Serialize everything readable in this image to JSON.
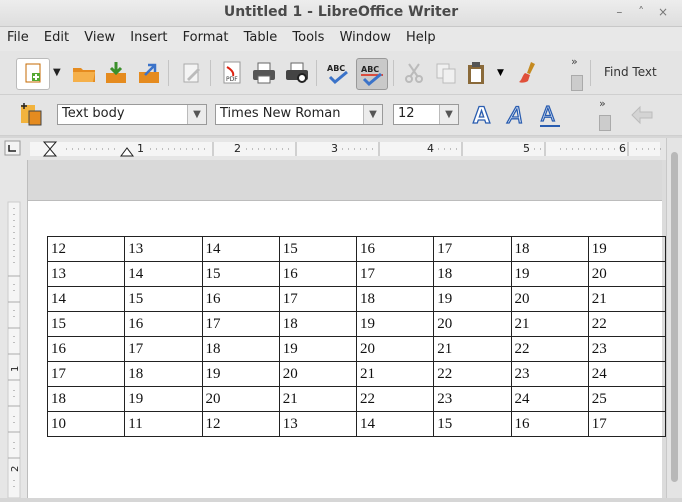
{
  "window": {
    "title": "Untitled 1 - LibreOffice Writer",
    "buttons": [
      "–",
      "˄",
      "×"
    ]
  },
  "menu": [
    "File",
    "Edit",
    "View",
    "Insert",
    "Format",
    "Table",
    "Tools",
    "Window",
    "Help"
  ],
  "toolbar": {
    "find_label": "Find Text"
  },
  "formatting": {
    "style": "Text body",
    "font": "Times New Roman",
    "size": "12"
  },
  "ruler": {
    "numbers": [
      "1",
      "2",
      "3",
      "4",
      "5",
      "6"
    ]
  },
  "vruler": {
    "numbers": [
      "1",
      "2"
    ]
  },
  "table": {
    "rows": [
      [
        "12",
        "13",
        "14",
        "15",
        "16",
        "17",
        "18",
        "19"
      ],
      [
        "13",
        "14",
        "15",
        "16",
        "17",
        "18",
        "19",
        "20"
      ],
      [
        "14",
        "15",
        "16",
        "17",
        "18",
        "19",
        "20",
        "21"
      ],
      [
        "15",
        "16",
        "17",
        "18",
        "19",
        "20",
        "21",
        "22"
      ],
      [
        "16",
        "17",
        "18",
        "19",
        "20",
        "21",
        "22",
        "23"
      ],
      [
        "17",
        "18",
        "19",
        "20",
        "21",
        "22",
        "23",
        "24"
      ],
      [
        "18",
        "19",
        "20",
        "21",
        "22",
        "23",
        "24",
        "25"
      ],
      [
        "10",
        "11",
        "12",
        "13",
        "14",
        "15",
        "16",
        "17"
      ]
    ]
  }
}
